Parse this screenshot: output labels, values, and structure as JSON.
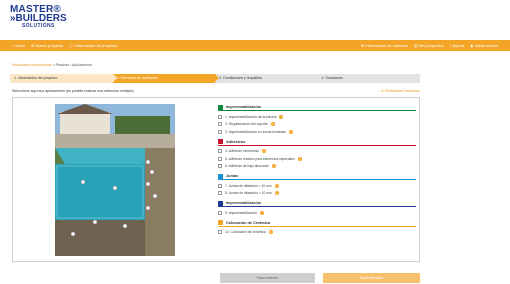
{
  "logo": {
    "line1": "MASTER®",
    "line2": "»BUILDERS",
    "line3": "SOLUTIONS"
  },
  "nav": {
    "left": [
      "Inicio",
      "Nuevo proyecto",
      "Información de proyecto"
    ],
    "right": [
      "Información de contacto",
      "Mis proyectos",
      "Ayuda",
      "Iniciar sesión"
    ]
  },
  "breadcrumb": {
    "link": "Soluciones constructivas",
    "current": "Piscinas / Aplicaciones"
  },
  "steps": [
    "1. Información del proyecto",
    "2. Selección de aplicación",
    "3. Condiciones y requisitos",
    "4. Soluciones"
  ],
  "instruction": "Seleccione aquí sus aplicaciones (es posible realizar una selección múltiple)",
  "reset_label": "Restablecer selección",
  "groups": [
    {
      "title": "Impermeabilización",
      "color": "#0e8a3e",
      "options": [
        {
          "label": "1. Impermeabilización de la piscina",
          "selected": false
        },
        {
          "label": "2. Regularización del soporte",
          "selected": false
        },
        {
          "label": "3. Impermeabilización en zonas húmedas",
          "selected": false
        }
      ]
    },
    {
      "title": "Adhesivos",
      "color": "#c8102e",
      "options": [
        {
          "label": "4. Adhesivo cementoso",
          "selected": false
        },
        {
          "label": "5. Adhesivo reactivo para elementos especiales",
          "selected": false
        },
        {
          "label": "6. Adhesivo de baja absorción",
          "selected": false
        }
      ]
    },
    {
      "title": "Juntas",
      "color": "#1c8fd0",
      "options": [
        {
          "label": "7. Juntas de dilatación > 10 mm",
          "selected": false
        },
        {
          "label": "8. Juntas de dilatación < 10 mm",
          "selected": false
        }
      ]
    },
    {
      "title": "Impermeabilización",
      "color": "#1c3b8f",
      "options": [
        {
          "label": "9. Impermeabilización",
          "selected": false
        }
      ]
    },
    {
      "title": "Colocación de Cerámica",
      "color": "#f3a528",
      "options": [
        {
          "label": "10. Colocación de cerámica",
          "selected": false
        }
      ]
    }
  ],
  "buttons": {
    "back": "Paso anterior",
    "next": "Siguiente paso"
  }
}
